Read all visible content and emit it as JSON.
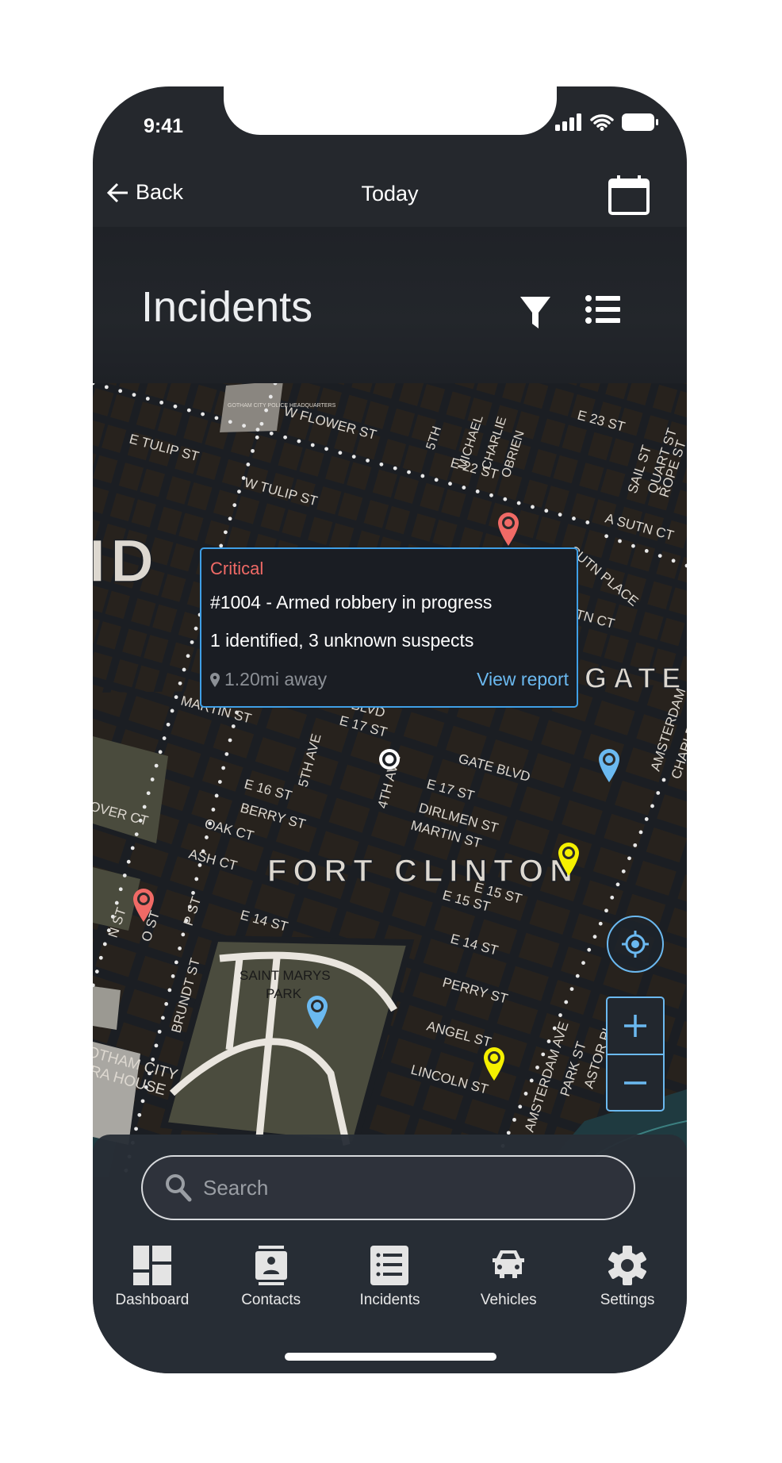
{
  "status_bar": {
    "time": "9:41"
  },
  "nav": {
    "back_label": "Back",
    "title": "Today",
    "calendar_icon": "calendar-icon"
  },
  "header": {
    "title": "Incidents",
    "filter_icon": "filter-icon",
    "list_icon": "list-icon"
  },
  "map": {
    "labels": [
      "W FLOWER ST",
      "E TULIP ST",
      "W TULIP ST",
      "E 22 ST",
      "ID",
      "GATE",
      "E 17 ST",
      "E 16 ST",
      "BERRY ST",
      "GATE BLVD",
      "E 17 ST",
      "DIRLMEN ST",
      "MARTIN ST",
      "FORT CLINTON",
      "E 15 ST",
      "E 14 ST",
      "E 14 ST",
      "OAK CT",
      "ASH CT",
      "SAINT MARYS",
      "PARK",
      "PERRY ST",
      "ANGEL ST",
      "LINCOLN ST",
      "AMSTERDAM AVE",
      "PARK ST",
      "ASTOR PL",
      "N ST",
      "O ST",
      "P ST",
      "BRUNDT ST",
      "OTHAM CITY",
      "RA HOUSE",
      "5TH",
      "MICHAEL",
      "CHARLIE",
      "OBRIEN",
      "SAIL ST",
      "QUART ST",
      "ROPE ST",
      "A SUTN CT",
      "SUTN PLACE",
      "SUTN CT",
      "4TH AVE",
      "5TH AVE",
      "AMSTERDAM",
      "CHARLES PL",
      "MARTIN ST",
      "E 15 ST",
      "OVER CT",
      "GOTHAM CITY POLICE HEADQUARTERS",
      "E 23 ST",
      "BLVD"
    ],
    "markers": [
      {
        "severity": "critical",
        "color": "#f06a66"
      },
      {
        "severity": "info",
        "color": "#6bb9f0"
      },
      {
        "severity": "warning",
        "color": "#f5f000"
      },
      {
        "severity": "critical",
        "color": "#f06a66"
      },
      {
        "severity": "info",
        "color": "#6bb9f0"
      },
      {
        "severity": "warning",
        "color": "#f5f000"
      }
    ],
    "zoom_in": "+",
    "zoom_out": "−"
  },
  "popup": {
    "severity": "Critical",
    "severity_color": "#f06a66",
    "title": "#1004 - Armed robbery in progress",
    "description": "1 identified, 3 unknown suspects",
    "distance": "1.20mi away",
    "link": "View report",
    "accent": "#3f9fe6"
  },
  "search": {
    "placeholder": "Search",
    "value": ""
  },
  "tabs": [
    {
      "label": "Dashboard",
      "icon": "dashboard-icon"
    },
    {
      "label": "Contacts",
      "icon": "contacts-icon"
    },
    {
      "label": "Incidents",
      "icon": "incidents-icon"
    },
    {
      "label": "Vehicles",
      "icon": "car-icon"
    },
    {
      "label": "Settings",
      "icon": "gear-icon"
    }
  ]
}
